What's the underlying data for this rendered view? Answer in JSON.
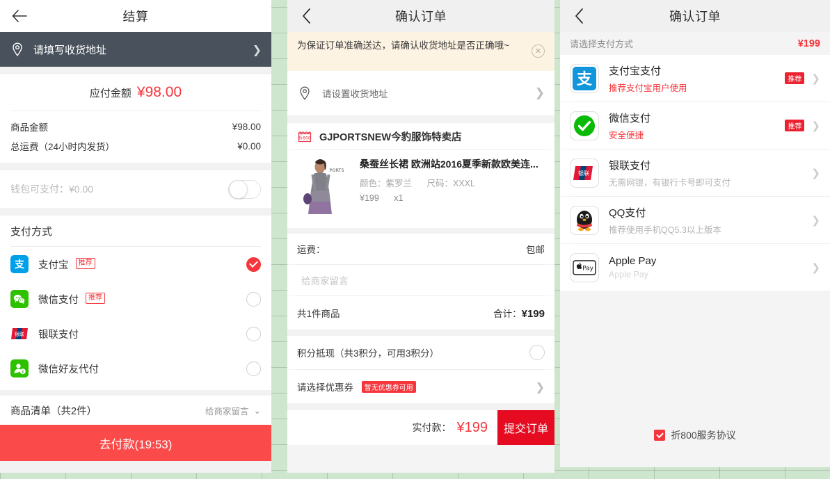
{
  "left_panel": {
    "nav": {
      "title": "结算",
      "back_icon": "arrow-left-icon"
    },
    "address_bar": {
      "icon": "location-pin-icon",
      "text": "请填写收货地址",
      "chevron": "chevron-right-icon"
    },
    "payable": {
      "label": "应付金额",
      "amount": "¥98.00"
    },
    "summary": [
      {
        "label": "商品金额",
        "value": "¥98.00"
      },
      {
        "label": "总运费（24小时内发货）",
        "value": "¥0.00"
      }
    ],
    "wallet": {
      "label": "钱包可支付：¥0.00",
      "toggle_on": false
    },
    "pay_section_title": "支付方式",
    "pay_methods": [
      {
        "name": "支付宝",
        "icon": "alipay-icon",
        "tag": "推荐",
        "selected": true
      },
      {
        "name": "微信支付",
        "icon": "wechat-pay-icon",
        "tag": "推荐",
        "selected": false
      },
      {
        "name": "银联支付",
        "icon": "unionpay-icon",
        "tag": "",
        "selected": false
      },
      {
        "name": "微信好友代付",
        "icon": "wechat-friend-pay-icon",
        "tag": "",
        "selected": false
      }
    ],
    "goods_list": {
      "label": "商品清单（共2件）",
      "note": "给商家留言",
      "chevron": "chevron-down-icon"
    },
    "cta": "去付款(19:53)"
  },
  "middle_panel": {
    "nav": {
      "title": "确认订单",
      "back_icon": "chevron-left-icon"
    },
    "notice": {
      "text": "为保证订单准确送达，请确认收货地址是否正确哦~",
      "close_icon": "close-circle-icon"
    },
    "address": {
      "icon": "location-pin-icon",
      "text": "请设置收货地址",
      "chevron": "chevron-right-icon"
    },
    "shop": {
      "icon": "shop-icon",
      "name": "GJPORTSNEW今豹服饰特卖店"
    },
    "product": {
      "thumb": "dress-photo",
      "title": "桑蚕丝长裙 欧洲站2016夏季新款欧美连...",
      "color_label": "颜色：紫罗兰",
      "size_label": "尺码：XXXL",
      "price": "¥199",
      "qty": "x1"
    },
    "shipping": {
      "label": "运费：",
      "value": "包邮"
    },
    "message_placeholder": "给商家留言",
    "totals": {
      "label": "共1件商品",
      "value_label": "合计：",
      "value": "¥199"
    },
    "points": {
      "label": "积分抵现（共3积分，可用3积分）",
      "checked": false
    },
    "coupon": {
      "label": "请选择优惠券",
      "tag": "暂无优惠券可用",
      "chevron": "chevron-right-icon"
    },
    "footer": {
      "label": "实付款：",
      "amount": "¥199",
      "submit": "提交订单"
    }
  },
  "right_panel": {
    "nav": {
      "title": "确认订单",
      "back_icon": "chevron-left-icon"
    },
    "header": {
      "label": "请选择支付方式",
      "amount": "¥199"
    },
    "methods": [
      {
        "icon": "alipay-icon",
        "title": "支付宝支付",
        "subtitle": "推荐支付宝用户使用",
        "subtitle_style": "red",
        "tag": "推荐",
        "chevron": "chevron-right-icon"
      },
      {
        "icon": "wechat-pay-icon",
        "title": "微信支付",
        "subtitle": "安全便捷",
        "subtitle_style": "red",
        "tag": "推荐",
        "chevron": "chevron-right-icon"
      },
      {
        "icon": "unionpay-icon",
        "title": "银联支付",
        "subtitle": "无需网银，有银行卡号即可支付",
        "subtitle_style": "grey",
        "tag": "",
        "chevron": "chevron-right-icon"
      },
      {
        "icon": "qq-penguin-icon",
        "title": "QQ支付",
        "subtitle": "推荐使用手机QQ5.3以上版本",
        "subtitle_style": "grey",
        "tag": "",
        "chevron": "chevron-right-icon"
      },
      {
        "icon": "apple-pay-icon",
        "title": "Apple Pay",
        "subtitle": "Apple Pay",
        "subtitle_style": "pale",
        "tag": "",
        "chevron": "chevron-right-icon"
      }
    ],
    "agreement": {
      "checked": true,
      "label": "折800服务协议"
    }
  },
  "colors": {
    "accent_red": "#f5363c",
    "cta_red": "#fb4a4a",
    "submit_red": "#e60b20",
    "dark_bar": "#49525c",
    "notice_bg": "#fdf3e3",
    "page_bg": "#cde6cd"
  }
}
